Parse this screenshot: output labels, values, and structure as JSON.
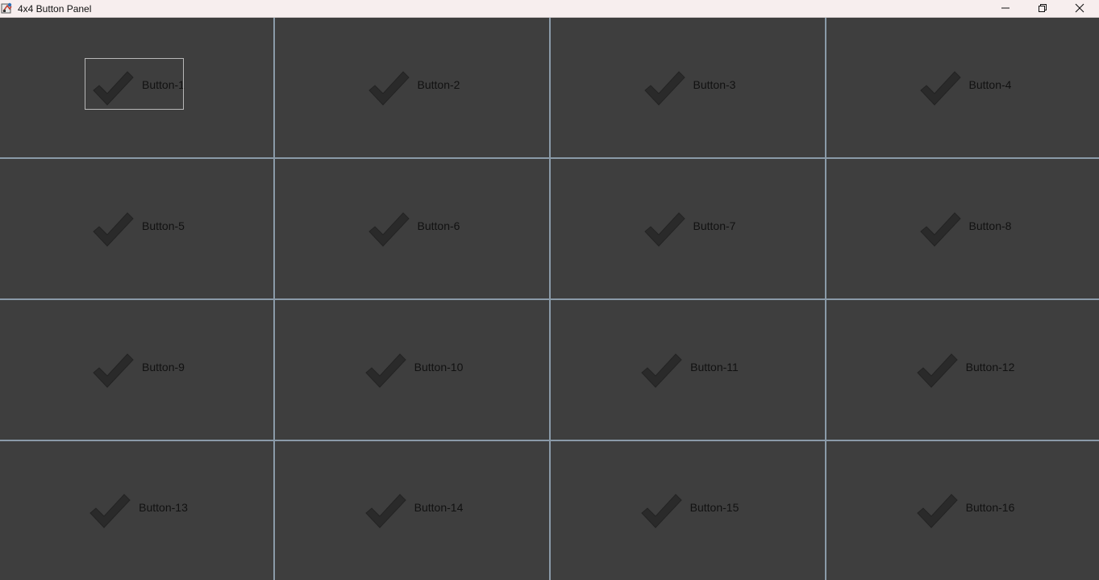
{
  "window": {
    "title": "4x4 Button Panel",
    "icon": "java-app-icon",
    "controls": [
      "minimize-icon",
      "maximize-icon",
      "close-icon"
    ]
  },
  "colors": {
    "titlebar_bg": "#f7eeee",
    "panel_bg": "#3e3e3e",
    "grid_line": "#8a9aa8",
    "checkmark": "#2a2a2a",
    "text": "#111111"
  },
  "buttons": [
    {
      "label": "Button-1",
      "icon": "checkmark-icon",
      "focused": true
    },
    {
      "label": "Button-2",
      "icon": "checkmark-icon"
    },
    {
      "label": "Button-3",
      "icon": "checkmark-icon"
    },
    {
      "label": "Button-4",
      "icon": "checkmark-icon"
    },
    {
      "label": "Button-5",
      "icon": "checkmark-icon"
    },
    {
      "label": "Button-6",
      "icon": "checkmark-icon"
    },
    {
      "label": "Button-7",
      "icon": "checkmark-icon"
    },
    {
      "label": "Button-8",
      "icon": "checkmark-icon"
    },
    {
      "label": "Button-9",
      "icon": "checkmark-icon"
    },
    {
      "label": "Button-10",
      "icon": "checkmark-icon"
    },
    {
      "label": "Button-11",
      "icon": "checkmark-icon"
    },
    {
      "label": "Button-12",
      "icon": "checkmark-icon"
    },
    {
      "label": "Button-13",
      "icon": "checkmark-icon"
    },
    {
      "label": "Button-14",
      "icon": "checkmark-icon"
    },
    {
      "label": "Button-15",
      "icon": "checkmark-icon"
    },
    {
      "label": "Button-16",
      "icon": "checkmark-icon"
    }
  ]
}
